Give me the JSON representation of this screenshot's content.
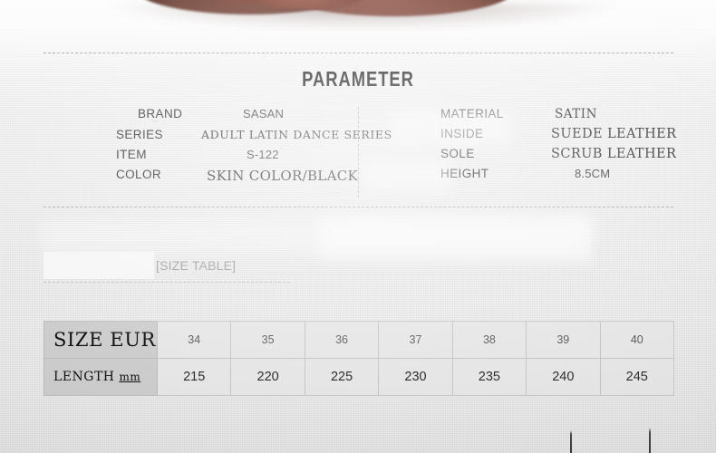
{
  "page": {
    "background_color": "#e4e4e4",
    "title": "PARAMETER"
  },
  "photo": {
    "caption": "cropped-product-photo-top",
    "object": "dance-shoe",
    "color": "#6d3f34"
  },
  "parameters": {
    "left": [
      {
        "label": "BRAND",
        "value": "SASAN"
      },
      {
        "label": "SERIES",
        "value": "ADULT LATIN DANCE SERIES"
      },
      {
        "label": "ITEM",
        "value": "S-122"
      },
      {
        "label": "COLOR",
        "value": "SKIN COLOR/BLACK"
      }
    ],
    "right": [
      {
        "label": "MATERIAL",
        "value": "SATIN"
      },
      {
        "label": "INSIDE",
        "value": "SUEDE LEATHER"
      },
      {
        "label": "SOLE",
        "value": "SCRUB LEATHER"
      },
      {
        "label": "HEIGHT",
        "value": "8.5CM"
      }
    ]
  },
  "size_table_placeholder": {
    "text": "[SIZE TABLE]"
  },
  "size_table": {
    "row_headers": {
      "size": "SIZE EUR",
      "length": "LENGTH",
      "length_unit": "mm"
    },
    "sizes": [
      "34",
      "35",
      "36",
      "37",
      "38",
      "39",
      "40"
    ],
    "lengths": [
      "215",
      "220",
      "225",
      "230",
      "235",
      "240",
      "245"
    ],
    "header_bg": "#cdcdcd",
    "cell_bg": "#e6e6e6",
    "border_color": "#c6c6c6"
  }
}
